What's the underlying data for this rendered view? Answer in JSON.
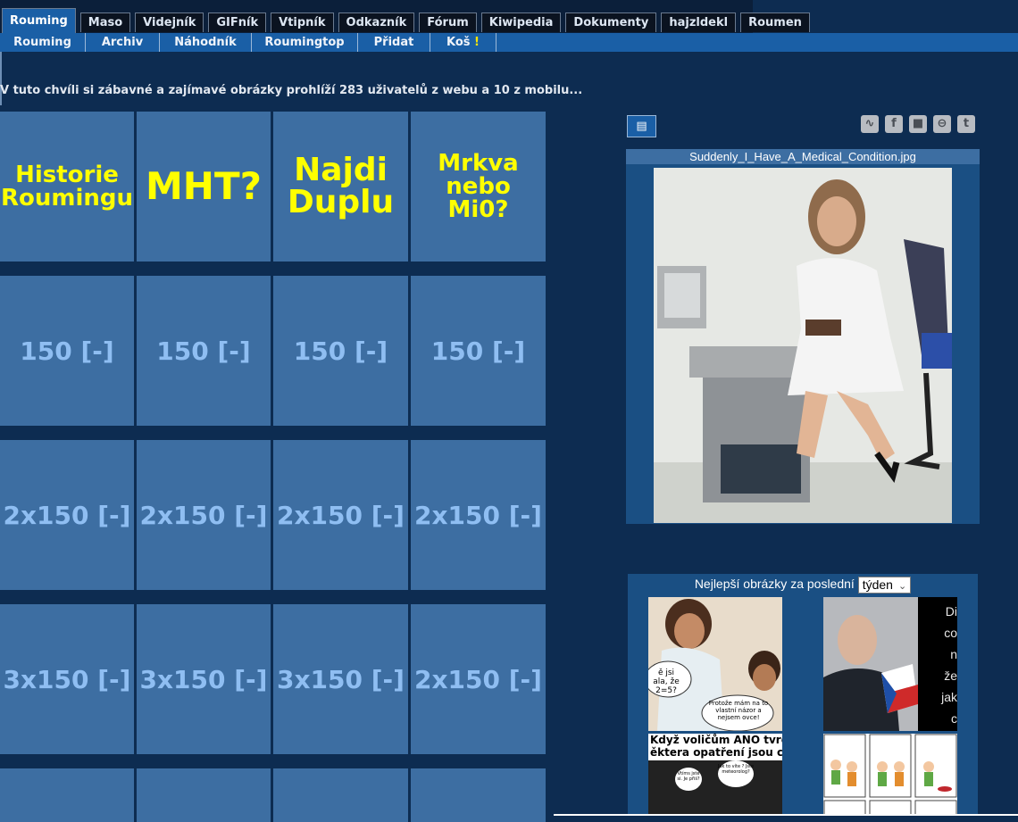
{
  "tabs": [
    "Rouming",
    "Maso",
    "Videjník",
    "GIFník",
    "Vtipník",
    "Odkazník",
    "Fórum",
    "Kiwipedia",
    "Dokumenty",
    "hajzldekl",
    "Roumen"
  ],
  "subnav": [
    "Rouming",
    "Archiv",
    "Náhodník",
    "Roumingtop",
    "Přidat",
    "Koš"
  ],
  "subnav_bang": "!",
  "users_line": "V tuto chvíli si zábavné a zajímavé obrázky prohlíží 283 uživatelů z webu a 10 z mobilu...",
  "grid": {
    "row1": [
      "Historie Roumingu",
      "MHT?",
      "Najdi Duplu",
      "Mrkva nebo Mi0?"
    ],
    "row2": [
      "150 [-]",
      "150 [-]",
      "150 [-]",
      "150 [-]"
    ],
    "row3": [
      "2x150 [-]",
      "2x150 [-]",
      "2x150 [-]",
      "2x150 [-]"
    ],
    "row4": [
      "3x150 [-]",
      "3x150 [-]",
      "3x150 [-]",
      "2x150 [-]"
    ]
  },
  "image": {
    "filename": "Suddenly_I_Have_A_Medical_Condition.jpg"
  },
  "best": {
    "label": "Nejlepší obrázky za poslední",
    "period": "týden",
    "thumbs": [
      {
        "bubbles": [
          "ě jsi",
          "ala, že",
          "2=5?"
        ],
        "reply": "Protože mám na to vlastní názor a nejsem ovce!"
      },
      {
        "side_text": [
          "Di",
          "co",
          "n",
          "že",
          "jak",
          "c"
        ]
      },
      {
        "caption": [
          "Když voličům ANO tvrdíš, že",
          "ěktera opatření jsou chybná"
        ],
        "bubbles": [
          "Vtíms jste si. Je přiš?",
          "Jak to víte ? Jste meteorolog?"
        ]
      },
      {
        "comic": true
      }
    ]
  },
  "colors": {
    "background": "#0d2c51",
    "tab_active": "#1a5fa6",
    "cell": "#3d6ea2",
    "cell_yellow": "#ffff00",
    "cell_number": "#8fbef2"
  },
  "icons": [
    "rss-icon",
    "facebook-icon",
    "android-icon",
    "pinterest-icon",
    "twitter-icon",
    "menu-icon"
  ]
}
